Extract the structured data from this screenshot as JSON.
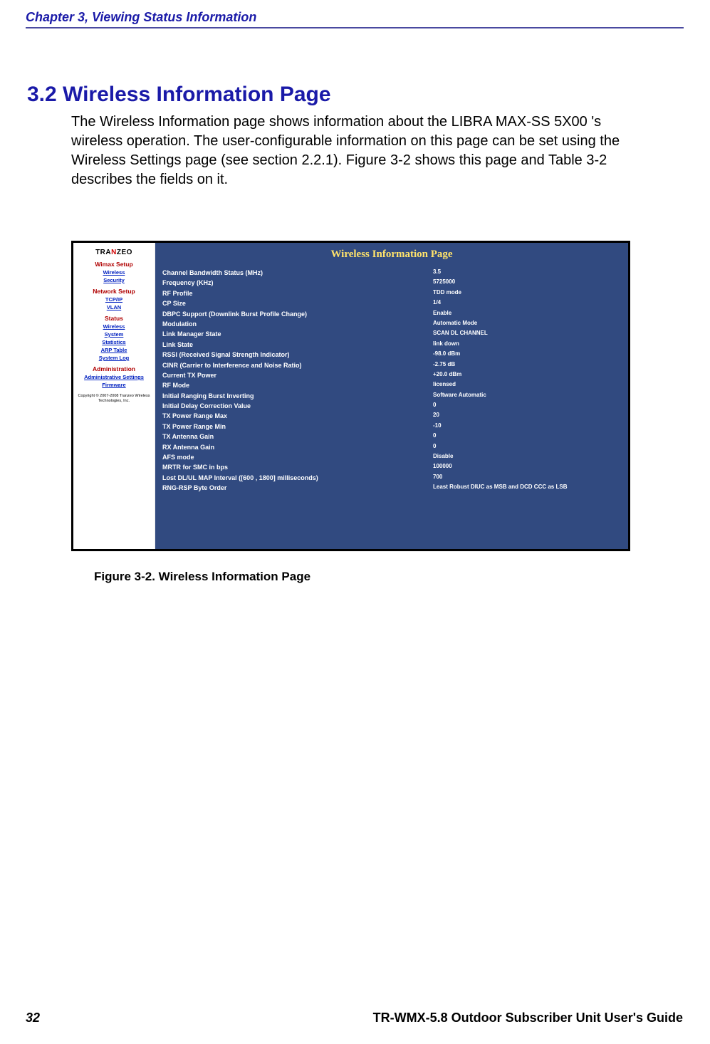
{
  "header": "Chapter 3, Viewing Status Information",
  "section_title": "3.2 Wireless Information Page",
  "body": "The Wireless Information page shows information about the LIBRA MAX-SS 5X00 's wireless operation. The user-configurable information on this page can be set using the Wireless Settings page (see section 2.2.1). Figure 3-2 shows this page and Table 3-2 describes the fields on it.",
  "figure": {
    "logo_pre": "TRA",
    "logo_z": "N",
    "logo_post": "ZEO",
    "sidebar": {
      "groups": [
        {
          "title": "Wimax Setup",
          "links": [
            "Wireless",
            "Security"
          ]
        },
        {
          "title": "Network Setup",
          "links": [
            "TCP/IP",
            "VLAN"
          ]
        },
        {
          "title": "Status",
          "links": [
            "Wireless",
            "System",
            "Statistics",
            "ARP Table",
            "System Log"
          ]
        },
        {
          "title": "Administration",
          "links": [
            "Administrative Settings",
            "Firmware"
          ]
        }
      ],
      "copyright": "Copyright © 2007-2008 Tranzeo Wireless Technologies, Inc."
    },
    "heading": "Wireless Information Page",
    "rows": [
      {
        "label": "Channel Bandwidth Status (MHz)",
        "value": "3.5"
      },
      {
        "label": "Frequency (KHz)",
        "value": "5725000"
      },
      {
        "label": "RF Profile",
        "value": "TDD mode"
      },
      {
        "label": "CP Size",
        "value": "1/4"
      },
      {
        "label": "DBPC Support (Downlink Burst Profile Change)",
        "value": "Enable"
      },
      {
        "label": "Modulation",
        "value": "Automatic Mode"
      },
      {
        "label": "Link Manager State",
        "value": "SCAN DL CHANNEL"
      },
      {
        "label": "Link State",
        "value": "link down"
      },
      {
        "label": "RSSI (Received Signal Strength Indicator)",
        "value": "-98.0 dBm"
      },
      {
        "label": "CINR (Carrier to Interference and Noise Ratio)",
        "value": "-2.75 dB"
      },
      {
        "label": "Current TX Power",
        "value": "+20.0 dBm"
      },
      {
        "label": "RF Mode",
        "value": "licensed"
      },
      {
        "label": "Initial Ranging Burst Inverting",
        "value": "Software Automatic"
      },
      {
        "label": "Initial Delay Correction Value",
        "value": "0"
      },
      {
        "label": "TX Power Range Max",
        "value": "20"
      },
      {
        "label": "TX Power Range Min",
        "value": "-10"
      },
      {
        "label": "TX Antenna Gain",
        "value": "0"
      },
      {
        "label": "RX Antenna Gain",
        "value": "0"
      },
      {
        "label": "AFS mode",
        "value": "Disable"
      },
      {
        "label": "MRTR for SMC in bps",
        "value": "100000"
      },
      {
        "label": "Lost DL/UL MAP Interval ([600 , 1800] milliseconds)",
        "value": "700"
      },
      {
        "label": "RNG-RSP Byte Order",
        "value": "Least Robust DIUC as MSB and DCD CCC as LSB"
      }
    ]
  },
  "figure_caption": "Figure 3-2. Wireless Information Page",
  "page_number": "32",
  "footer_title": "TR-WMX-5.8 Outdoor Subscriber Unit User's Guide"
}
